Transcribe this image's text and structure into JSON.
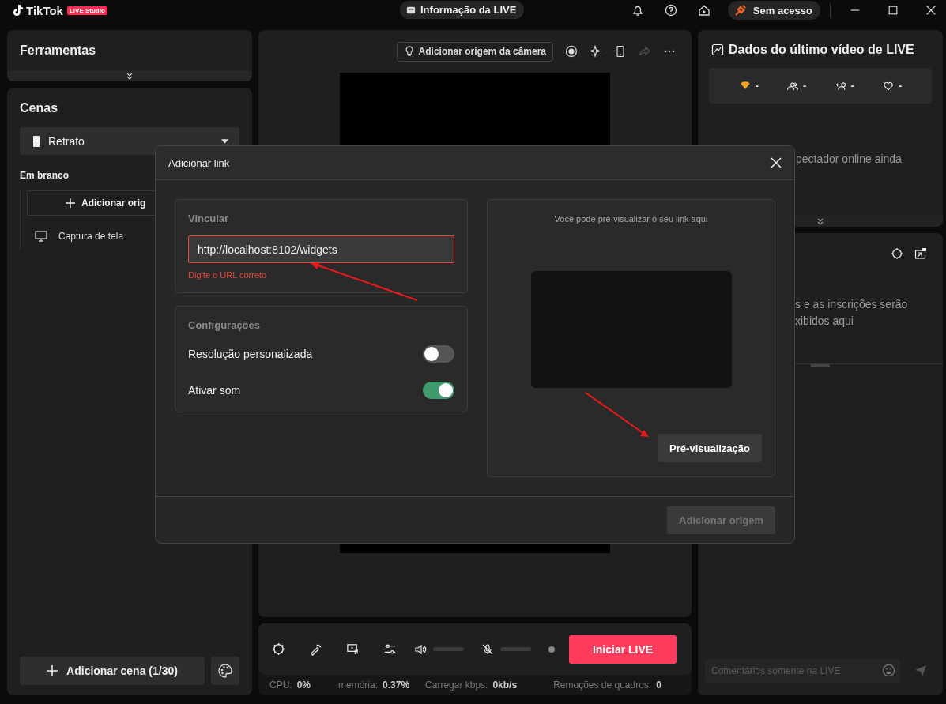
{
  "app": {
    "name": "TikTok",
    "badge": "LIVE Studio"
  },
  "topbar": {
    "live_info": "Informação da LIVE",
    "account": "Sem acesso"
  },
  "tools": {
    "title": "Ferramentas"
  },
  "scenes": {
    "title": "Cenas",
    "layout": "Retrato",
    "group": "Em branco",
    "add_source": "Adicionar orig",
    "sources": [
      {
        "label": "Captura de tela"
      }
    ],
    "add_scene": "Adicionar cena (1/30)"
  },
  "preview": {
    "camera_button": "Adicionar origem da câmera"
  },
  "controls": {
    "start": "Iniciar LIVE",
    "volume": {
      "level": 0
    },
    "mic": {
      "level": 0
    }
  },
  "status_bar": [
    {
      "label": "CPU:",
      "value": "0%"
    },
    {
      "label": "memória:",
      "value": "0.37%"
    },
    {
      "label": "Carregar kbps:",
      "value": "0kb/s"
    },
    {
      "label": "Remoções de quadros:",
      "value": "0"
    }
  ],
  "stats": {
    "title": "Dados do último vídeo de LIVE",
    "items": [
      {
        "kind": "diamonds",
        "value": "-"
      },
      {
        "kind": "viewers",
        "value": "-"
      },
      {
        "kind": "followers",
        "value": "-"
      },
      {
        "kind": "likes",
        "value": "-"
      }
    ],
    "message": "pectador online ainda"
  },
  "comments": {
    "message_lines": [
      "s e as inscrições serão",
      "xibidos aqui"
    ],
    "placeholder": "Comentários somente na LIVE"
  },
  "dialog": {
    "title": "Adicionar link",
    "link_label": "Vincular",
    "url": {
      "value": "http://localhost:8102/widgets",
      "invalid": true
    },
    "error": "Digite o URL correto",
    "settings_title": "Configurações",
    "settings": [
      {
        "label": "Resolução personalizada",
        "on": false
      },
      {
        "label": "Ativar som",
        "on": true
      }
    ],
    "preview_hint": "Você pode pré-visualizar o seu link aqui",
    "preview_button": "Pré-visualização",
    "submit": {
      "label": "Adicionar origem",
      "disabled": true
    }
  }
}
